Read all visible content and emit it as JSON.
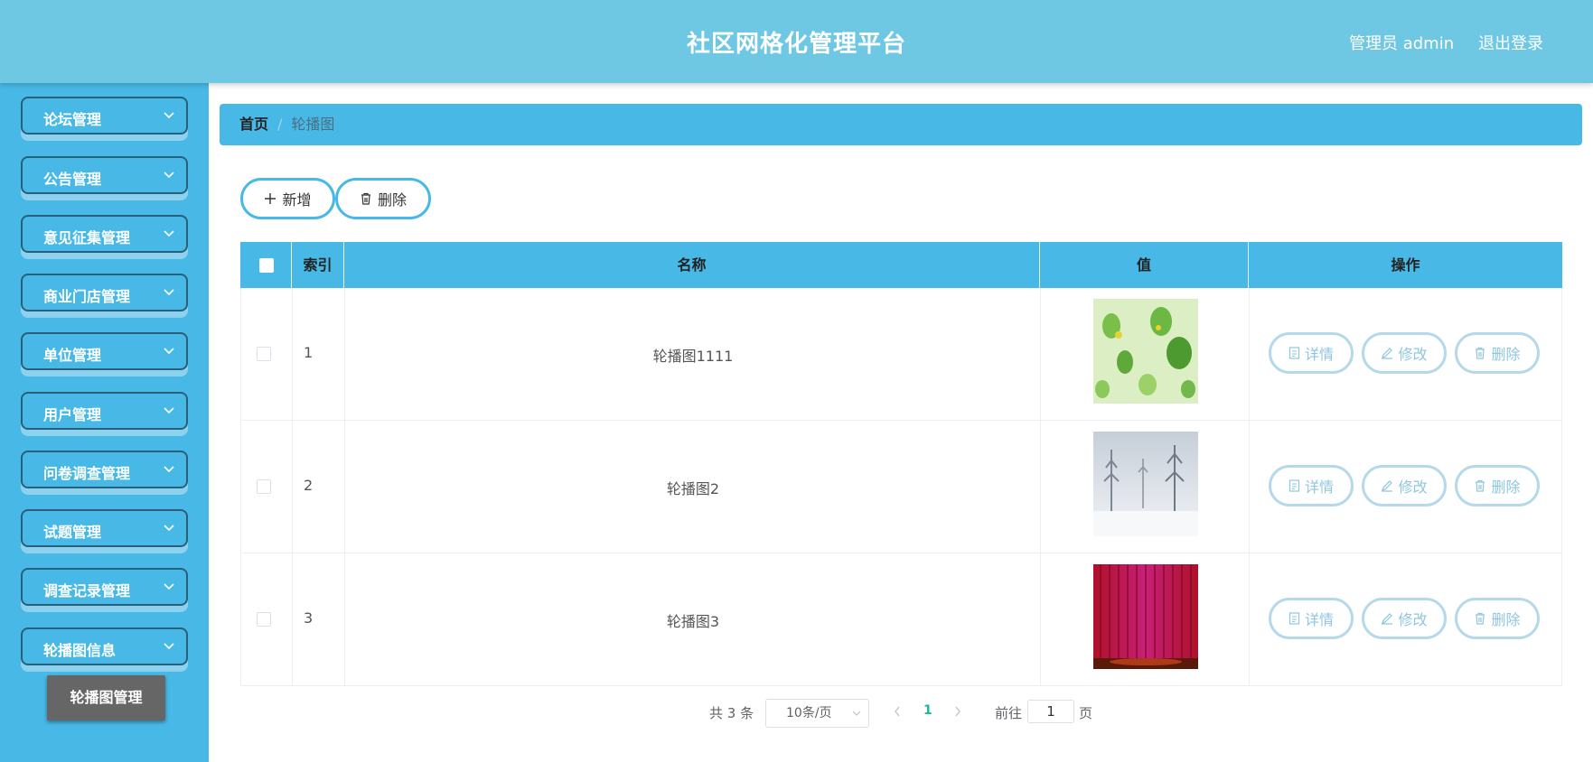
{
  "header": {
    "title": "社区网格化管理平台",
    "user": "管理员 admin",
    "logout": "退出登录"
  },
  "sidebar": {
    "items": [
      {
        "label": "论坛管理"
      },
      {
        "label": "公告管理"
      },
      {
        "label": "意见征集管理"
      },
      {
        "label": "商业门店管理"
      },
      {
        "label": "单位管理"
      },
      {
        "label": "用户管理"
      },
      {
        "label": "问卷调查管理"
      },
      {
        "label": "试题管理"
      },
      {
        "label": "调查记录管理"
      },
      {
        "label": "轮播图信息"
      }
    ],
    "submenu": "轮播图管理"
  },
  "breadcrumb": {
    "home": "首页",
    "separator": "/",
    "current": "轮播图"
  },
  "toolbar": {
    "add": "新增",
    "delete": "删除"
  },
  "table": {
    "columns": [
      "索引",
      "名称",
      "值",
      "操作"
    ],
    "rows": [
      {
        "index": "1",
        "name": "轮播图1111",
        "image": "green-leaves"
      },
      {
        "index": "2",
        "name": "轮播图2",
        "image": "snowy-forest"
      },
      {
        "index": "3",
        "name": "轮播图3",
        "image": "red-curtain"
      }
    ],
    "actions": {
      "detail": "详情",
      "edit": "修改",
      "delete": "删除"
    }
  },
  "pagination": {
    "total": "共 3 条",
    "page_size": "10条/页",
    "current_page": "1",
    "goto_label": "前往",
    "goto_value": "1",
    "page_suffix": "页"
  },
  "colors": {
    "header": "#6ec7e3",
    "primary": "#48b9e6",
    "menu_border": "#2a5f79",
    "submenu": "#666666",
    "page_active": "#1fb5a0"
  }
}
